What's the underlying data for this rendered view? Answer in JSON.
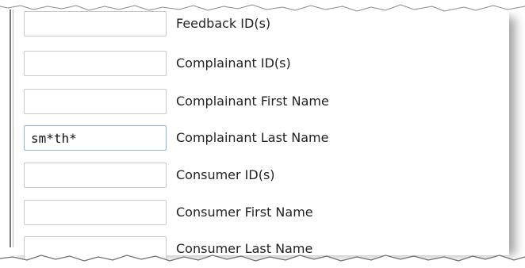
{
  "search_form": {
    "fields": [
      {
        "label": "Feedback ID(s)",
        "value": ""
      },
      {
        "label": "Complainant ID(s)",
        "value": ""
      },
      {
        "label": "Complainant First Name",
        "value": ""
      },
      {
        "label": "Complainant Last Name",
        "value": "sm*th*"
      },
      {
        "label": "Consumer ID(s)",
        "value": ""
      },
      {
        "label": "Consumer First Name",
        "value": ""
      },
      {
        "label": "Consumer Last Name",
        "value": ""
      }
    ]
  },
  "colors": {
    "field_border": "#c9c9c9",
    "active_field_border": "#8fb3d6",
    "label_text": "#222222"
  }
}
